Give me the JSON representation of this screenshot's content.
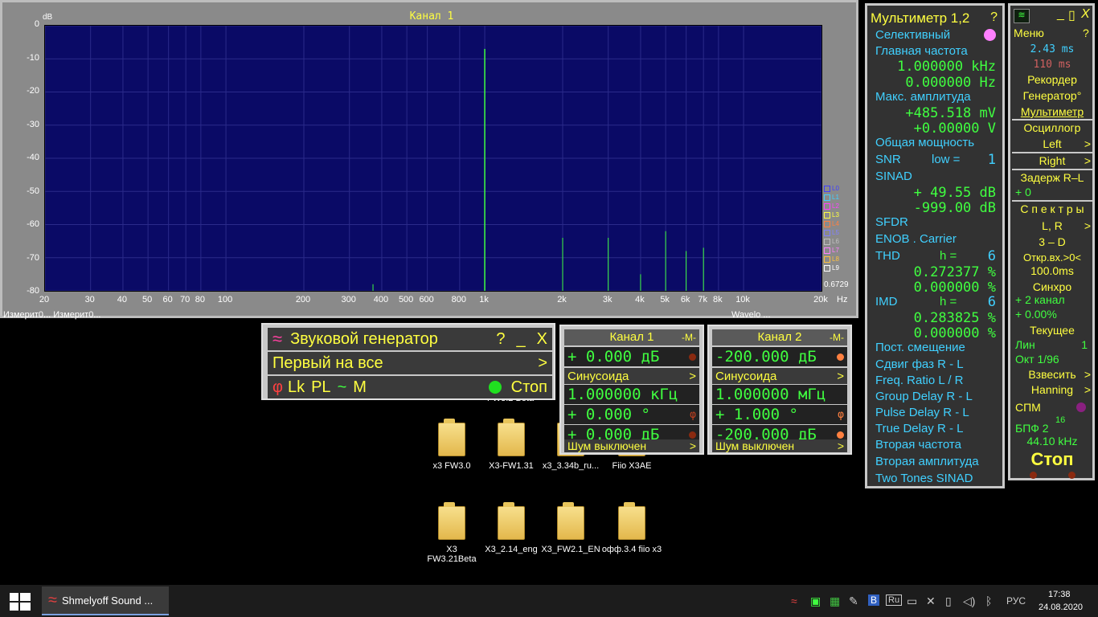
{
  "spectrum": {
    "title": "Канал 1",
    "unit": "dB",
    "value": "0.6729",
    "hz": "Hz",
    "yticks": [
      "0",
      "-10",
      "-20",
      "-30",
      "-40",
      "-50",
      "-60",
      "-70",
      "-80"
    ],
    "xticks": [
      "20",
      "30",
      "40",
      "50",
      "60",
      "70",
      "80",
      "100",
      "200",
      "300",
      "400",
      "500",
      "600",
      "800",
      "1k",
      "2k",
      "3k",
      "4k",
      "5k",
      "6k",
      "7k",
      "8k",
      "10k",
      "20k"
    ],
    "legend": [
      "L0",
      "L1",
      "L2",
      "L3",
      "L4",
      "L5",
      "L6",
      "L7",
      "L8",
      "L9"
    ],
    "legend_colors": [
      "#4040ff",
      "#40d0ff",
      "#ff40ff",
      "#ffff40",
      "#ff8040",
      "#8080ff",
      "#c0c0c0",
      "#ff80ff",
      "#ffc040",
      "#ffffff"
    ]
  },
  "chart_data": {
    "type": "bar",
    "ylabel": "dB",
    "ylim": [
      -80,
      0
    ],
    "xscale": "log",
    "xlim": [
      20,
      20000
    ],
    "x": [
      370,
      1000,
      2000,
      3000,
      4000,
      5000,
      6000,
      7000
    ],
    "values": [
      -78,
      -7,
      -64,
      -64,
      -75,
      -62,
      -68,
      -67
    ]
  },
  "desktop": {
    "top_partial": "Измерит0...   Измерит0...",
    "wavelo": "Wavelo ...",
    "under_gen": "FW3.2 Beta",
    "icons": [
      {
        "label": "x3 FW3.0"
      },
      {
        "label": "X3-FW1.31"
      },
      {
        "label": "x3_3.34b_ru..."
      },
      {
        "label": "Fiio X3AE"
      },
      {
        "label": "X3 FW3.21Beta"
      },
      {
        "label": "X3_2.14_eng"
      },
      {
        "label": "X3_FW2.1_EN"
      },
      {
        "label": "офф.3.4 fiio x3"
      }
    ]
  },
  "generator": {
    "title": "Звуковой генератор",
    "help": "?",
    "min": "_",
    "close": "X",
    "first": "Первый на все",
    "arrow": ">",
    "lk": "Lk",
    "pl": "PL",
    "tilde": "~",
    "m": "M",
    "stop": "Стоп"
  },
  "ch1": {
    "title": "Канал 1",
    "m": "-M-",
    "level": "+ 0.000 дБ",
    "wave": "Синусоида",
    "freq": "1.000000 кГц",
    "phase": "+ 0.000 °",
    "level2": "+ 0.000 дБ",
    "noise": "Шум выключен"
  },
  "ch2": {
    "title": "Канал 2",
    "m": "-M-",
    "level": "-200.000 дБ",
    "wave": "Синусоида",
    "freq": "1.000000 мГц",
    "phase": "+ 1.000 °",
    "level2": "-200.000 дБ",
    "noise": "Шум выключен"
  },
  "mm": {
    "title": "Мультиметр 1,2",
    "help": "?",
    "selective": "Селективный",
    "main_freq": "Главная частота",
    "f1": "1.000000 kHz",
    "f2": "0.000000  Hz",
    "max_amp": "Макс. амплитуда",
    "a1": "+485.518 mV",
    "a2": "+0.00000  V",
    "total": "Общая мощность",
    "snr": "SNR",
    "low": "low =",
    "low_v": "1",
    "sinad": "SINAD",
    "s1": "+ 49.55 dB",
    "s2": "-999.00 dB",
    "sfdr": "SFDR",
    "enob": "ENOB . Carrier",
    "thd": "THD",
    "h1": "h =",
    "h1v": "6",
    "t1": "0.272377 %",
    "t2": "0.000000 %",
    "imd": "IMD",
    "h2": "h =",
    "h2v": "6",
    "i1": "0.283825 %",
    "i2": "0.000000 %",
    "items": [
      "Пост. смещение",
      "Сдвиг фаз R - L",
      "Freq. Ratio  L / R",
      "Group Delay R - L",
      "Pulse Delay R - L",
      "True Delay R - L",
      "Вторая частота",
      "Вторая амплитуда",
      "Two Tones SINAD"
    ]
  },
  "rp": {
    "min": "_",
    "max": "▯",
    "close": "X",
    "menu": "Меню",
    "help": "?",
    "t1": "2.43 ms",
    "t2": "110  ms",
    "recorder": "Рекордер",
    "generator": "Генератор°",
    "multimeter": "Мультиметр",
    "osc": "Осциллогр",
    "left": "Left",
    "right": "Right",
    "delay": "Задерж  R–L",
    "delay_v": "+      0",
    "spectra": "С п е к т р ы",
    "lr": "L, R",
    "d3": "3 – D",
    "open": "Откр.вх.>0<",
    "open_v": "100.0ms",
    "sync": "Синхро",
    "sync2": "+  2 канал",
    "sync3": "+  0.00%",
    "current": "Текущее",
    "lin": "Лин",
    "lin_v": "1",
    "oct": "Окт  1/96",
    "weigh": "Взвесить",
    "hanning": "Hanning",
    "spm": "СПМ",
    "fft": "БПФ  2",
    "fft_exp": "16",
    "rate": "44.10 kHz",
    "stop": "Стоп"
  },
  "taskbar": {
    "app": "Shmelyoff Sound ...",
    "lang": "РУС",
    "time": "17:38",
    "date": "24.08.2020",
    "ru": "Ru"
  }
}
